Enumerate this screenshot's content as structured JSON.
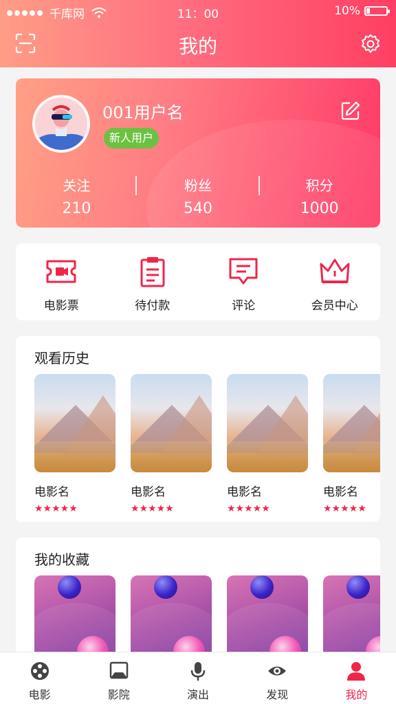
{
  "status_bar": {
    "carrier": "千库网",
    "time": "11：00",
    "battery": "10%"
  },
  "header": {
    "title": "我的",
    "left_icon": "scan-icon",
    "right_icon": "gear-icon"
  },
  "profile": {
    "username": "001用户名",
    "tag": "新人用户",
    "edit_icon": "edit-icon",
    "stats": [
      {
        "label": "关注",
        "value": "210"
      },
      {
        "label": "粉丝",
        "value": "540"
      },
      {
        "label": "积分",
        "value": "1000"
      }
    ]
  },
  "quick_actions": [
    {
      "label": "电影票",
      "icon": "ticket-icon"
    },
    {
      "label": "待付款",
      "icon": "clipboard-icon"
    },
    {
      "label": "评论",
      "icon": "comment-icon"
    },
    {
      "label": "会员中心",
      "icon": "crown-icon"
    }
  ],
  "history": {
    "title": "观看历史",
    "items": [
      {
        "name": "电影名",
        "rating": 5
      },
      {
        "name": "电影名",
        "rating": 5
      },
      {
        "name": "电影名",
        "rating": 5
      },
      {
        "name": "电影名",
        "rating": 5
      }
    ]
  },
  "favorites": {
    "title": "我的收藏"
  },
  "tabbar": {
    "items": [
      {
        "label": "电影",
        "icon": "film-reel-icon"
      },
      {
        "label": "影院",
        "icon": "cinema-screen-icon"
      },
      {
        "label": "演出",
        "icon": "microphone-icon"
      },
      {
        "label": "发现",
        "icon": "eye-icon"
      },
      {
        "label": "我的",
        "icon": "user-icon"
      }
    ],
    "active": "我的"
  },
  "colors": {
    "accent": "#f0254a",
    "header_start": "#ff9d86",
    "header_end": "#ff3f63",
    "tag_bg": "#6cc142"
  }
}
